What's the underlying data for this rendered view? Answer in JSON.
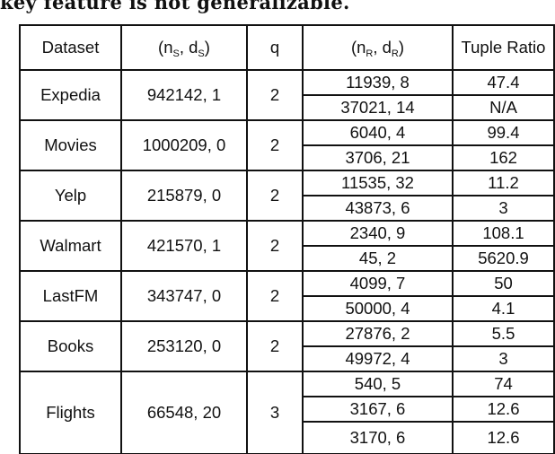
{
  "caption_tail": "key feature is not generalizable.",
  "table": {
    "headers": {
      "dataset": "Dataset",
      "ns_ds": {
        "open": "(n",
        "sub1": "S",
        "mid": ", d",
        "sub2": "S",
        "close": ")"
      },
      "q": "q",
      "nr_dr": {
        "open": "(n",
        "sub1": "R",
        "mid": ", d",
        "sub2": "R",
        "close": ")"
      },
      "tuple_ratio": "Tuple Ratio"
    },
    "groups": [
      {
        "dataset": "Expedia",
        "ns_ds": "942142, 1",
        "q": "2",
        "rows": [
          {
            "nr_dr": "11939, 8",
            "tuple_ratio": "47.4"
          },
          {
            "nr_dr": "37021, 14",
            "tuple_ratio": "N/A"
          }
        ]
      },
      {
        "dataset": "Movies",
        "ns_ds": "1000209, 0",
        "q": "2",
        "rows": [
          {
            "nr_dr": "6040, 4",
            "tuple_ratio": "99.4"
          },
          {
            "nr_dr": "3706, 21",
            "tuple_ratio": "162"
          }
        ]
      },
      {
        "dataset": "Yelp",
        "ns_ds": "215879, 0",
        "q": "2",
        "rows": [
          {
            "nr_dr": "11535, 32",
            "tuple_ratio": "11.2"
          },
          {
            "nr_dr": "43873, 6",
            "tuple_ratio": "3"
          }
        ]
      },
      {
        "dataset": "Walmart",
        "ns_ds": "421570, 1",
        "q": "2",
        "rows": [
          {
            "nr_dr": "2340, 9",
            "tuple_ratio": "108.1"
          },
          {
            "nr_dr": "45, 2",
            "tuple_ratio": "5620.9"
          }
        ]
      },
      {
        "dataset": "LastFM",
        "ns_ds": "343747, 0",
        "q": "2",
        "rows": [
          {
            "nr_dr": "4099, 7",
            "tuple_ratio": "50"
          },
          {
            "nr_dr": "50000, 4",
            "tuple_ratio": "4.1"
          }
        ]
      },
      {
        "dataset": "Books",
        "ns_ds": "253120, 0",
        "q": "2",
        "rows": [
          {
            "nr_dr": "27876, 2",
            "tuple_ratio": "5.5"
          },
          {
            "nr_dr": "49972, 4",
            "tuple_ratio": "3"
          }
        ]
      },
      {
        "dataset": "Flights",
        "ns_ds": "66548, 20",
        "q": "3",
        "rows": [
          {
            "nr_dr": "540, 5",
            "tuple_ratio": "74"
          },
          {
            "nr_dr": "3167, 6",
            "tuple_ratio": "12.6"
          },
          {
            "nr_dr": "3170, 6",
            "tuple_ratio": "12.6"
          }
        ]
      }
    ]
  }
}
